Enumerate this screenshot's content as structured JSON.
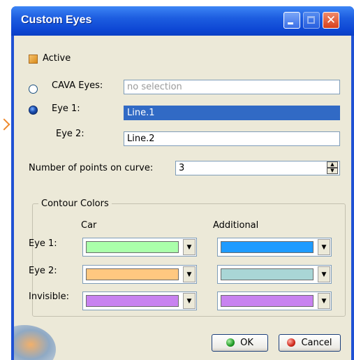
{
  "window": {
    "title": "Custom Eyes"
  },
  "active": {
    "label": "Active",
    "checked": true
  },
  "eyes": {
    "cava": {
      "label": "CAVA Eyes:",
      "value": "no selection",
      "selected": false
    },
    "eye1": {
      "label": "Eye 1:",
      "value": "Line.1",
      "selected": true
    },
    "eye2": {
      "label": "Eye 2:",
      "value": "Line.2"
    }
  },
  "points": {
    "label": "Number of points on curve:",
    "value": "3"
  },
  "contour_colors": {
    "title": "Contour Colors",
    "col_car": "Car",
    "col_additional": "Additional",
    "rows": [
      {
        "label": "Eye 1:",
        "car_color": "#aaffaa",
        "additional_color": "#1e9bff"
      },
      {
        "label": "Eye 2:",
        "car_color": "#ffc880",
        "additional_color": "#a9d6d6"
      },
      {
        "label": "Invisible:",
        "car_color": "#c882f0",
        "additional_color": "#c882f0"
      }
    ]
  },
  "buttons": {
    "ok": "OK",
    "cancel": "Cancel"
  },
  "icons": {
    "minimize": "minimize-icon",
    "maximize": "maximize-icon",
    "close": "close-icon",
    "ok": "green-dot-icon",
    "cancel": "red-dot-icon",
    "spin": "spin-updown-icon",
    "dropdown": "chevron-down-icon"
  }
}
